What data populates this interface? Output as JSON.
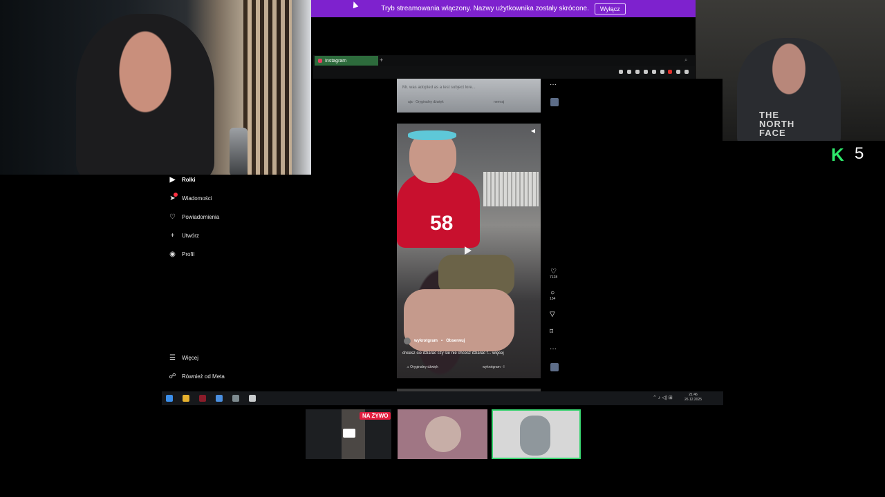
{
  "banner": {
    "text": "Tryb streamowania włączony. Nazwy użytkownika zostały skrócone.",
    "button": "Wyłącz"
  },
  "browser": {
    "tab_label": "Instagram",
    "new_tab": "+"
  },
  "sidebar": {
    "items": [
      {
        "label": "Rolki",
        "icon": "reels-icon",
        "active": true
      },
      {
        "label": "Wiadomości",
        "icon": "messenger-icon",
        "badge": true
      },
      {
        "label": "Powiadomienia",
        "icon": "heart-icon"
      },
      {
        "label": "Utwórz",
        "icon": "plus-icon"
      },
      {
        "label": "Profil",
        "icon": "avatar-icon"
      }
    ],
    "bottom": [
      {
        "label": "Więcej",
        "icon": "menu-icon"
      },
      {
        "label": "Również od Meta",
        "icon": "meta-icon"
      }
    ]
  },
  "previous_post": {
    "caption": "Mr. was adopted as a test subject lore...",
    "audio": "aja · Oryginalny dźwięk",
    "follow": "nemraj"
  },
  "reel": {
    "jersey_number": "58",
    "username": "wykrotgram",
    "separator": "•",
    "follow": "Obserwuj",
    "description": "chcesz sie dziarac czy sie nie chcesz dziarac f... więcej",
    "audio": "Oryginalny dźwięk",
    "audio_owner": "wykrotgram · I",
    "likes": "7128",
    "comments": "134",
    "more": "···"
  },
  "taskbar": {
    "time": "21:46",
    "date": "26.12.2025"
  },
  "overlay": {
    "k_letter": "K",
    "k_number": "5",
    "cam_shirt": "THE NORTH FACE"
  },
  "thumbnails": {
    "live_badge": "NA ŻYWO"
  }
}
